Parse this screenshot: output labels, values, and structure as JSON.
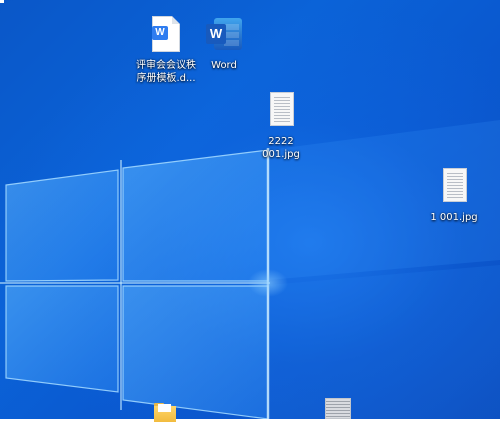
{
  "desktop": {
    "background_color": "#0b5fd4",
    "icons": [
      {
        "name": "wps-doc",
        "label_line1": "评审会会议秩",
        "label_line2": "序册模板.d..."
      },
      {
        "name": "word-app",
        "label_line1": "Word",
        "label_line2": ""
      },
      {
        "name": "jpg-2222",
        "label_line1": "2222",
        "label_line2": "001.jpg"
      },
      {
        "name": "jpg-1",
        "label_line1": "1 001.jpg",
        "label_line2": ""
      }
    ],
    "icon_glyphs": {
      "wps": "W",
      "word": "W"
    }
  }
}
